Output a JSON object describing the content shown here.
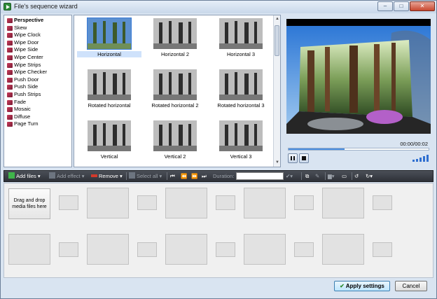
{
  "window": {
    "title": "File's sequence wizard",
    "min_glyph": "–",
    "max_glyph": "□",
    "close_glyph": "✕"
  },
  "effects": [
    {
      "label": "Perspective",
      "bold": true
    },
    {
      "label": "Skew"
    },
    {
      "label": "Wipe Clock"
    },
    {
      "label": "Wipe Door"
    },
    {
      "label": "Wipe Side"
    },
    {
      "label": "Wipe Center"
    },
    {
      "label": "Wipe Strips"
    },
    {
      "label": "Wipe Checker"
    },
    {
      "label": "Push Door"
    },
    {
      "label": "Push Side"
    },
    {
      "label": "Push Strips"
    },
    {
      "label": "Fade"
    },
    {
      "label": "Mosaic"
    },
    {
      "label": "Diffuse"
    },
    {
      "label": "Page Turn"
    }
  ],
  "thumbnails": [
    {
      "label": "Horizontal",
      "selected": true,
      "color": true
    },
    {
      "label": "Horizontal 2"
    },
    {
      "label": "Horizontal 3"
    },
    {
      "label": "Rotated horizontal"
    },
    {
      "label": "Rotated horizontal 2"
    },
    {
      "label": "Rotated horizontal 3"
    },
    {
      "label": "Vertical"
    },
    {
      "label": "Vertical 2"
    },
    {
      "label": "Vertical 3"
    }
  ],
  "preview": {
    "time": "00:00/00:02",
    "progress": 0.4
  },
  "toolbar": {
    "add_files": "Add files",
    "add_effect": "Add effect",
    "remove": "Remove",
    "select_all": "Select all",
    "duration_label": "Duration:"
  },
  "timeline": {
    "drop_text": "Drag and drop media files here"
  },
  "buttons": {
    "apply": "Apply settings",
    "cancel": "Cancel"
  },
  "colors": {
    "accent": "#3a7bd5",
    "toolbar": "#3a3d44",
    "effect_icon": "#b03050"
  }
}
